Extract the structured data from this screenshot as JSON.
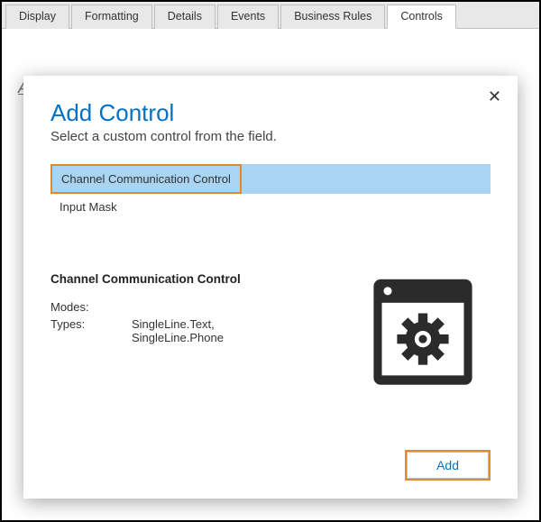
{
  "tabs": {
    "display": "Display",
    "formatting": "Formatting",
    "details": "Details",
    "events": "Events",
    "business_rules": "Business Rules",
    "controls": "Controls"
  },
  "bg": {
    "hint": "A"
  },
  "modal": {
    "title": "Add Control",
    "subtitle": "Select a custom control from the field.",
    "close": "✕",
    "list": {
      "item0": "Channel Communication Control",
      "item1": "Input Mask"
    },
    "details": {
      "title": "Channel Communication Control",
      "modes_key": "Modes:",
      "modes_val": "",
      "types_key": "Types:",
      "types_val": "SingleLine.Text,\nSingleLine.Phone"
    },
    "add_label": "Add"
  }
}
